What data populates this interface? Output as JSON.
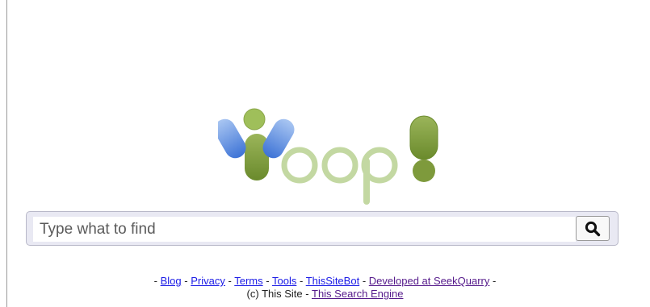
{
  "logo": {
    "text": "Yoop!"
  },
  "search": {
    "placeholder": "Type what to find",
    "value": "",
    "button_icon": "search-icon"
  },
  "footer": {
    "links": {
      "blog": "Blog",
      "privacy": "Privacy",
      "terms": "Terms",
      "tools": "Tools",
      "sitebot": "ThisSiteBot",
      "developed": "Developed at SeekQuarry",
      "engine": "This Search Engine"
    },
    "separator": "-",
    "copyright": "(c) This Site"
  },
  "colors": {
    "logo_blue": "#5b8fe0",
    "logo_green_dark": "#7e9a3c",
    "logo_green_light": "#b5cc90",
    "link": "#1a1ae6",
    "link_visited": "#551a8b"
  }
}
